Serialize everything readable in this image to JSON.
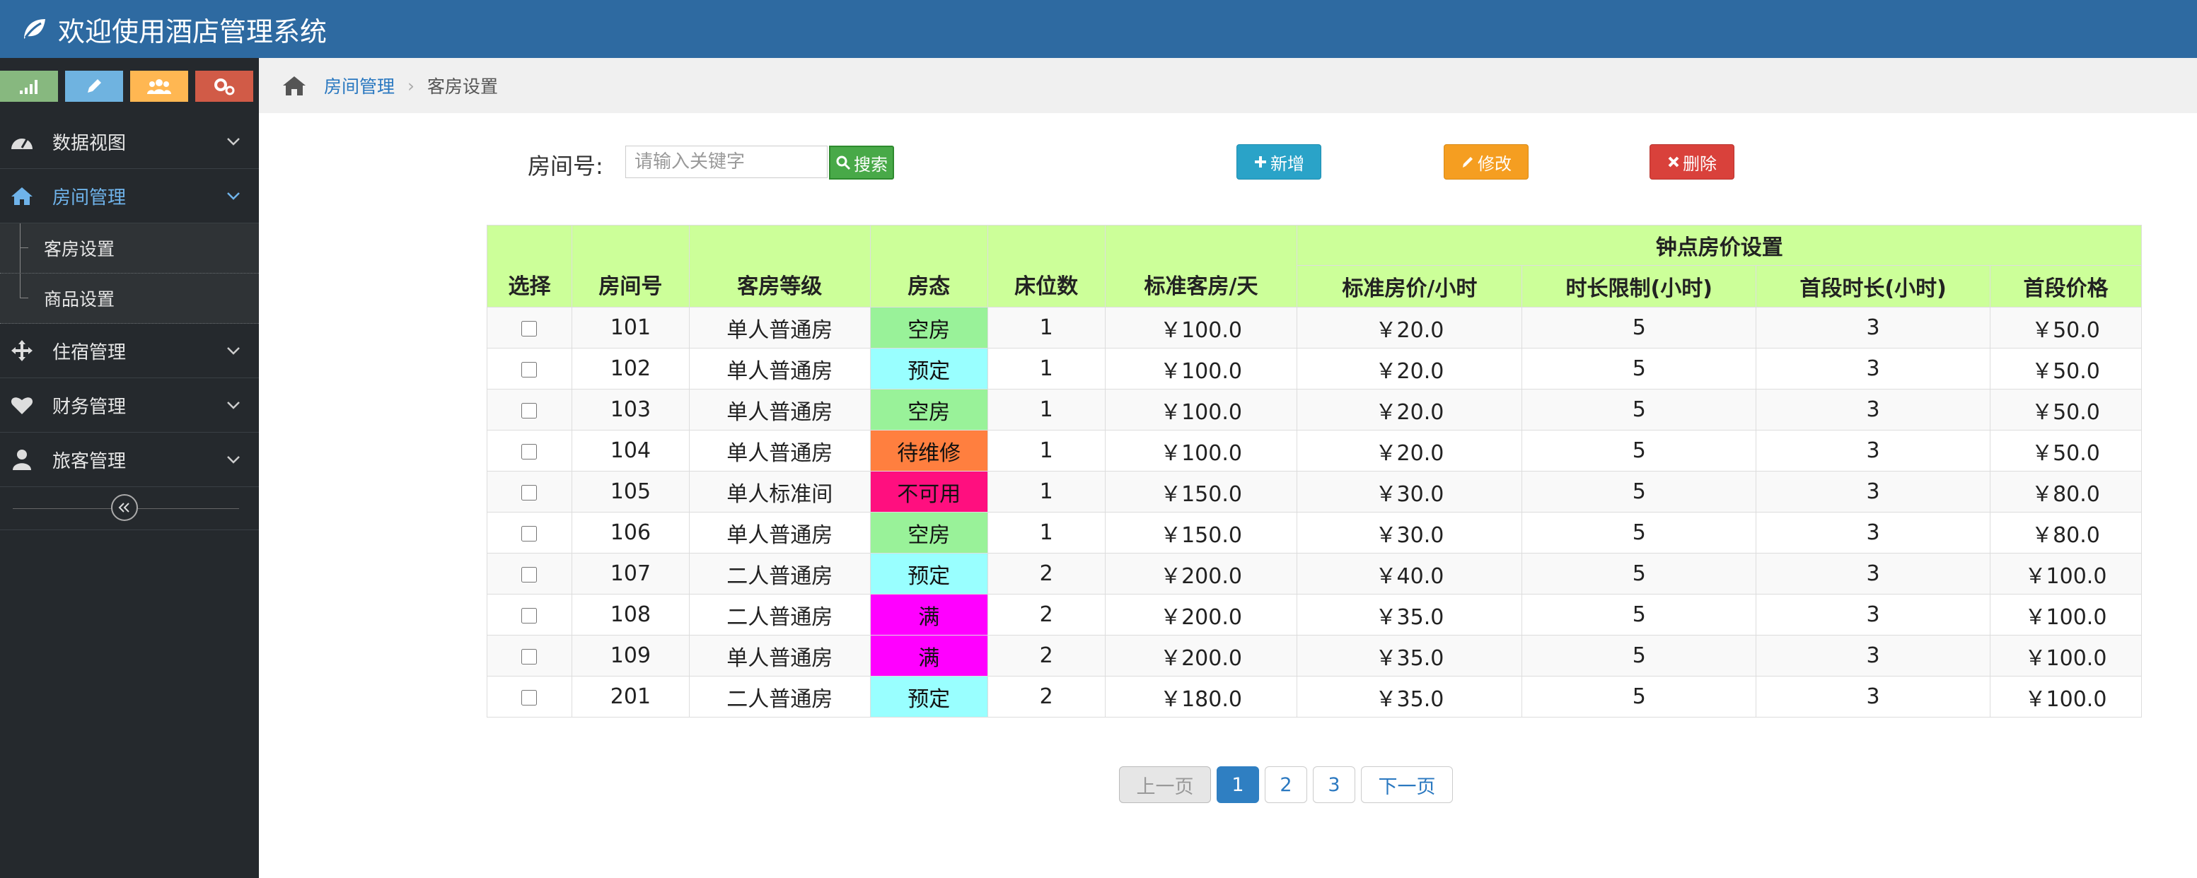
{
  "app": {
    "title": "欢迎使用酒店管理系统"
  },
  "shortcut_colors": [
    "#87b87f",
    "#6fb3e0",
    "#ffb752",
    "#d15b47"
  ],
  "sidebar": {
    "items": [
      {
        "label": "数据视图",
        "icon": "dashboard-icon"
      },
      {
        "label": "房间管理",
        "icon": "home-icon",
        "active": true,
        "children": [
          {
            "label": "客房设置"
          },
          {
            "label": "商品设置"
          }
        ]
      },
      {
        "label": "住宿管理",
        "icon": "move-icon"
      },
      {
        "label": "财务管理",
        "icon": "heart-icon"
      },
      {
        "label": "旅客管理",
        "icon": "user-icon"
      }
    ]
  },
  "breadcrumb": {
    "parent": "房间管理",
    "current": "客房设置"
  },
  "toolbar": {
    "room_label": "房间号:",
    "search_placeholder": "请输入关键字",
    "search_value": "",
    "search_label": "搜索",
    "add_label": "新增",
    "edit_label": "修改",
    "delete_label": "删除"
  },
  "table": {
    "group_header": "钟点房价设置",
    "headers": [
      "选择",
      "房间号",
      "客房等级",
      "房态",
      "床位数",
      "标准客房/天",
      "标准房价/小时",
      "时长限制(小时)",
      "首段时长(小时)",
      "首段价格"
    ],
    "status_colors": {
      "空房": "#99f299",
      "预定": "#99ffff",
      "待维修": "#ff7f3f",
      "不可用": "#ff0f7f",
      "满": "#ff00ff"
    },
    "rows": [
      {
        "room": "101",
        "grade": "单人普通房",
        "status": "空房",
        "beds": "1",
        "daily": "￥100.0",
        "hourly": "￥20.0",
        "limit": "5",
        "first_hours": "3",
        "first_price": "￥50.0"
      },
      {
        "room": "102",
        "grade": "单人普通房",
        "status": "预定",
        "beds": "1",
        "daily": "￥100.0",
        "hourly": "￥20.0",
        "limit": "5",
        "first_hours": "3",
        "first_price": "￥50.0"
      },
      {
        "room": "103",
        "grade": "单人普通房",
        "status": "空房",
        "beds": "1",
        "daily": "￥100.0",
        "hourly": "￥20.0",
        "limit": "5",
        "first_hours": "3",
        "first_price": "￥50.0"
      },
      {
        "room": "104",
        "grade": "单人普通房",
        "status": "待维修",
        "beds": "1",
        "daily": "￥100.0",
        "hourly": "￥20.0",
        "limit": "5",
        "first_hours": "3",
        "first_price": "￥50.0"
      },
      {
        "room": "105",
        "grade": "单人标准间",
        "status": "不可用",
        "beds": "1",
        "daily": "￥150.0",
        "hourly": "￥30.0",
        "limit": "5",
        "first_hours": "3",
        "first_price": "￥80.0"
      },
      {
        "room": "106",
        "grade": "单人普通房",
        "status": "空房",
        "beds": "1",
        "daily": "￥150.0",
        "hourly": "￥30.0",
        "limit": "5",
        "first_hours": "3",
        "first_price": "￥80.0"
      },
      {
        "room": "107",
        "grade": "二人普通房",
        "status": "预定",
        "beds": "2",
        "daily": "￥200.0",
        "hourly": "￥40.0",
        "limit": "5",
        "first_hours": "3",
        "first_price": "￥100.0"
      },
      {
        "room": "108",
        "grade": "二人普通房",
        "status": "满",
        "beds": "2",
        "daily": "￥200.0",
        "hourly": "￥35.0",
        "limit": "5",
        "first_hours": "3",
        "first_price": "￥100.0"
      },
      {
        "room": "109",
        "grade": "单人普通房",
        "status": "满",
        "beds": "2",
        "daily": "￥200.0",
        "hourly": "￥35.0",
        "limit": "5",
        "first_hours": "3",
        "first_price": "￥100.0"
      },
      {
        "room": "201",
        "grade": "二人普通房",
        "status": "预定",
        "beds": "2",
        "daily": "￥180.0",
        "hourly": "￥35.0",
        "limit": "5",
        "first_hours": "3",
        "first_price": "￥100.0"
      }
    ]
  },
  "pagination": {
    "prev_label": "上一页",
    "pages": [
      "1",
      "2",
      "3"
    ],
    "current": "1",
    "next_label": "下一页"
  }
}
